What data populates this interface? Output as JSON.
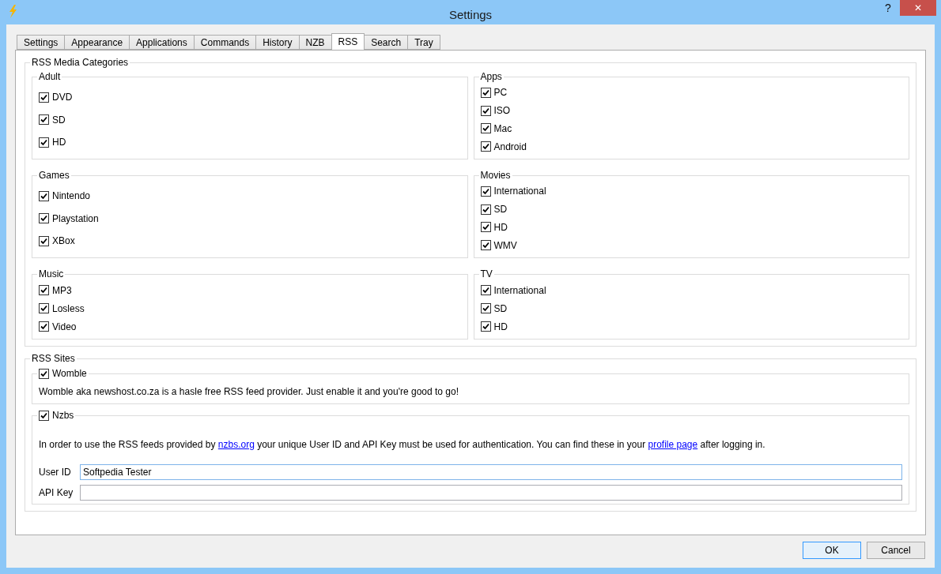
{
  "window": {
    "title": "Settings",
    "help_glyph": "?",
    "close_glyph": "✕"
  },
  "tabs": [
    {
      "label": "Settings",
      "selected": false
    },
    {
      "label": "Appearance",
      "selected": false
    },
    {
      "label": "Applications",
      "selected": false
    },
    {
      "label": "Commands",
      "selected": false
    },
    {
      "label": "History",
      "selected": false
    },
    {
      "label": "NZB",
      "selected": false
    },
    {
      "label": "RSS",
      "selected": true
    },
    {
      "label": "Search",
      "selected": false
    },
    {
      "label": "Tray",
      "selected": false
    }
  ],
  "media_categories": {
    "title": "RSS Media Categories",
    "groups": [
      {
        "title": "Adult",
        "items": [
          {
            "label": "DVD",
            "checked": true
          },
          {
            "label": "SD",
            "checked": true
          },
          {
            "label": "HD",
            "checked": true
          }
        ]
      },
      {
        "title": "Apps",
        "items": [
          {
            "label": "PC",
            "checked": true
          },
          {
            "label": "ISO",
            "checked": true
          },
          {
            "label": "Mac",
            "checked": true
          },
          {
            "label": "Android",
            "checked": true
          }
        ]
      },
      {
        "title": "Games",
        "items": [
          {
            "label": "Nintendo",
            "checked": true
          },
          {
            "label": "Playstation",
            "checked": true
          },
          {
            "label": "XBox",
            "checked": true
          }
        ]
      },
      {
        "title": "Movies",
        "items": [
          {
            "label": "International",
            "checked": true
          },
          {
            "label": "SD",
            "checked": true
          },
          {
            "label": "HD",
            "checked": true
          },
          {
            "label": "WMV",
            "checked": true
          }
        ]
      },
      {
        "title": "Music",
        "items": [
          {
            "label": "MP3",
            "checked": true
          },
          {
            "label": "Losless",
            "checked": true
          },
          {
            "label": "Video",
            "checked": true
          }
        ]
      },
      {
        "title": "TV",
        "items": [
          {
            "label": "International",
            "checked": true
          },
          {
            "label": "SD",
            "checked": true
          },
          {
            "label": "HD",
            "checked": true
          }
        ]
      }
    ]
  },
  "rss_sites": {
    "title": "RSS Sites",
    "sites": [
      {
        "name": "Womble",
        "checked": true,
        "description": [
          {
            "kind": "text",
            "text": "Womble aka newshost.co.za is a hasle free RSS feed provider. Just enable it and you're good to go!"
          }
        ]
      },
      {
        "name": "Nzbs",
        "checked": true,
        "description": [
          {
            "kind": "text",
            "text": "In order to use the RSS feeds provided by "
          },
          {
            "kind": "link",
            "text": "nzbs.org"
          },
          {
            "kind": "text",
            "text": " your unique User ID and API Key must be used for authentication. You can find these in your "
          },
          {
            "kind": "link",
            "text": "profile page"
          },
          {
            "kind": "text",
            "text": " after logging in."
          }
        ],
        "fields": [
          {
            "label": "User ID",
            "value": "Softpedia Tester",
            "focused": true
          },
          {
            "label": "API Key",
            "focused": false
          }
        ]
      }
    ]
  },
  "buttons": [
    {
      "label": "OK",
      "default": true
    },
    {
      "label": "Cancel",
      "default": false
    }
  ]
}
